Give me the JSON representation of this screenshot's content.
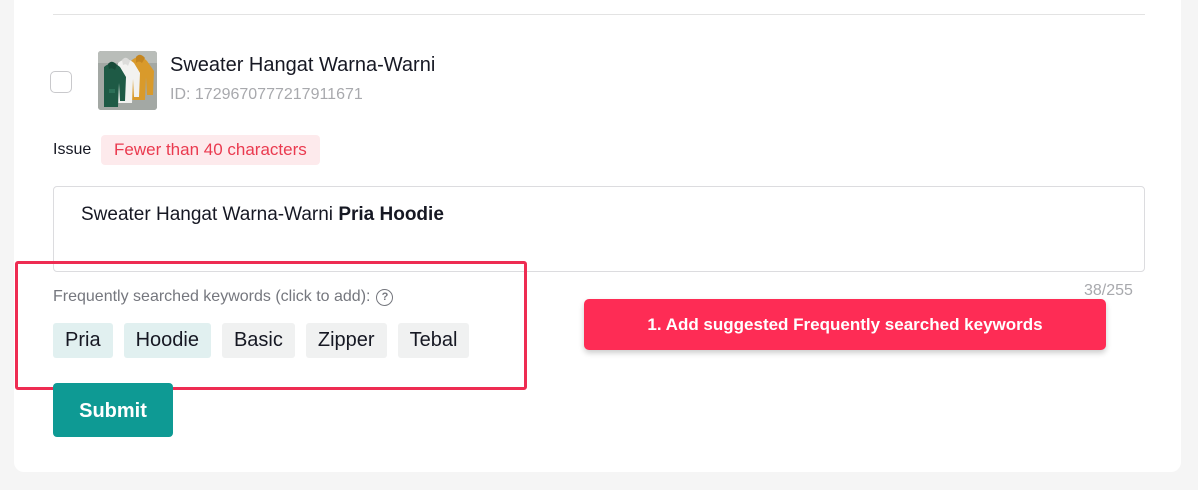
{
  "product": {
    "name": "Sweater Hangat Warna-Warni",
    "id_text": "ID: 1729670777217911671",
    "thumbnail_icon": "hoodie-product-image"
  },
  "issue": {
    "label": "Issue",
    "badge": "Fewer than 40 characters",
    "badge_color": "#ea3a4f"
  },
  "title_editor": {
    "text_plain": "Sweater Hangat Warna-Warni ",
    "text_added": "Pria Hoodie",
    "counter": "38/255"
  },
  "keywords": {
    "label": "Frequently searched keywords (click to add):",
    "help_icon": "question-circle-icon",
    "items": [
      {
        "label": "Pria",
        "added": true
      },
      {
        "label": "Hoodie",
        "added": true
      },
      {
        "label": "Basic",
        "added": false
      },
      {
        "label": "Zipper",
        "added": false
      },
      {
        "label": "Tebal",
        "added": false
      }
    ]
  },
  "submit_label": "Submit",
  "callout": {
    "text": "1. Add suggested Frequently searched keywords",
    "color": "#fe2c55"
  },
  "colors": {
    "primary": "#0e9a94",
    "highlight": "#ee2c52"
  }
}
